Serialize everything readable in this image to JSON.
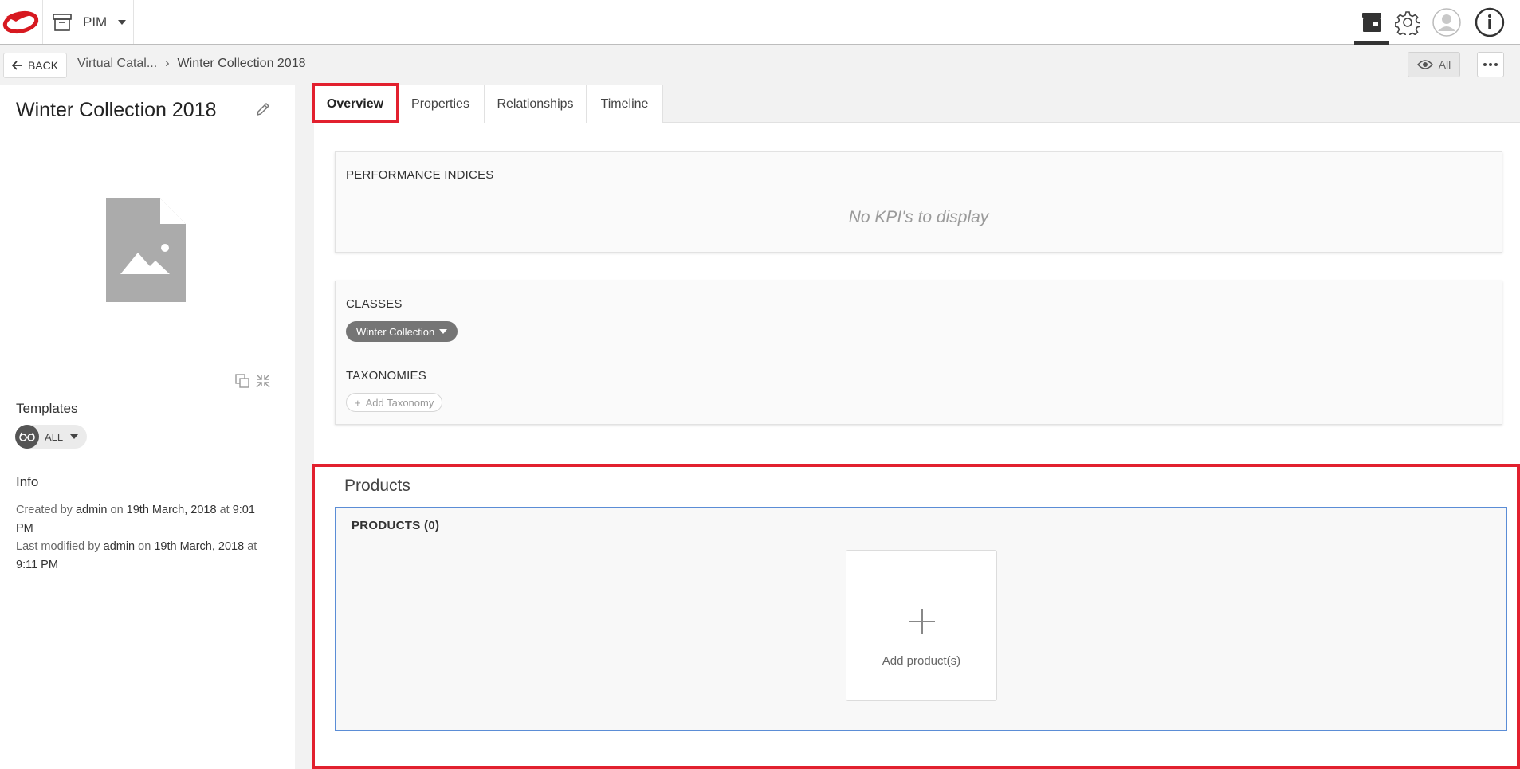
{
  "app": {
    "switcher_label": "PIM"
  },
  "subbar": {
    "back_label": "BACK",
    "breadcrumb_parent": "Virtual Catal...",
    "breadcrumb_current": "Winter Collection 2018",
    "view_label": "All"
  },
  "entity": {
    "title": "Winter Collection 2018"
  },
  "templates": {
    "label": "Templates",
    "chip_label": "ALL"
  },
  "info": {
    "label": "Info",
    "created_prefix": "Created by",
    "created_user": "admin",
    "created_on": "on",
    "created_date": "19th March, 2018",
    "created_at": "at",
    "created_time": "9:01 PM",
    "modified_prefix": "Last modified by",
    "modified_user": "admin",
    "modified_on": "on",
    "modified_date": "19th March, 2018",
    "modified_at": "at",
    "modified_time": "9:11 PM"
  },
  "tabs": [
    {
      "label": "Overview",
      "active": true
    },
    {
      "label": "Properties",
      "active": false
    },
    {
      "label": "Relationships",
      "active": false
    },
    {
      "label": "Timeline",
      "active": false
    }
  ],
  "performance": {
    "title": "PERFORMANCE INDICES",
    "empty_text": "No KPI's to display"
  },
  "classes": {
    "title": "CLASSES",
    "chip_label": "Winter Collection"
  },
  "taxonomies": {
    "title": "TAXONOMIES",
    "add_label": "Add Taxonomy"
  },
  "products": {
    "section_title": "Products",
    "panel_title": "PRODUCTS (0)",
    "add_label": "Add product(s)"
  },
  "colors": {
    "highlight": "#e2202e",
    "brand_red": "#d71920",
    "panel_border": "#5b8dd6"
  },
  "icons": {
    "logo": "brand-logo",
    "app": "archive-box-icon",
    "topbar": [
      "product-box-icon",
      "gear-icon",
      "user-avatar-icon",
      "info-icon"
    ],
    "back": "arrow-left-icon",
    "view": "eye-icon",
    "more": "ellipsis-icon",
    "edit": "pencil-icon",
    "thumb": "image-placeholder-icon",
    "tools": [
      "copy-image-icon",
      "collapse-icon"
    ],
    "templates": "glasses-icon",
    "add": "plus-icon"
  }
}
